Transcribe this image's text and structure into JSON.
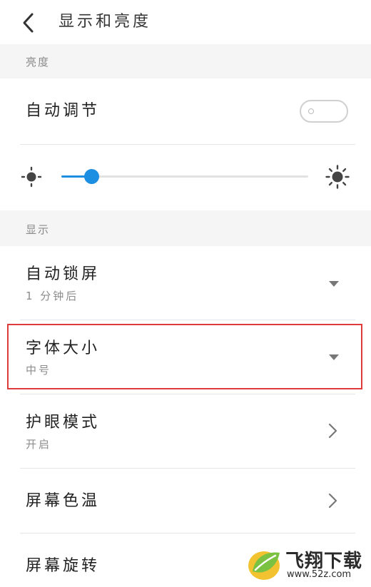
{
  "header": {
    "title": "显示和亮度",
    "back_icon": "chevron-left-icon"
  },
  "sections": {
    "brightness": {
      "label": "亮度"
    },
    "display": {
      "label": "显示"
    }
  },
  "auto_adjust": {
    "label": "自动调节",
    "enabled": false
  },
  "brightness_slider": {
    "value": 0.12,
    "min_icon": "sun-small-icon",
    "max_icon": "sun-large-icon",
    "accent": "#1d8fe3"
  },
  "items": [
    {
      "title": "自动锁屏",
      "subtitle": "1 分钟后",
      "control": "dropdown"
    },
    {
      "title": "字体大小",
      "subtitle": "中号",
      "control": "dropdown",
      "highlighted": true
    },
    {
      "title": "护眼模式",
      "subtitle": "开启",
      "control": "chevron"
    },
    {
      "title": "屏幕色温",
      "control": "chevron"
    },
    {
      "title": "屏幕旋转"
    }
  ],
  "watermark": {
    "brand": "飞翔下载",
    "url": "www.52z.com",
    "brand_color": "#7cc242"
  }
}
